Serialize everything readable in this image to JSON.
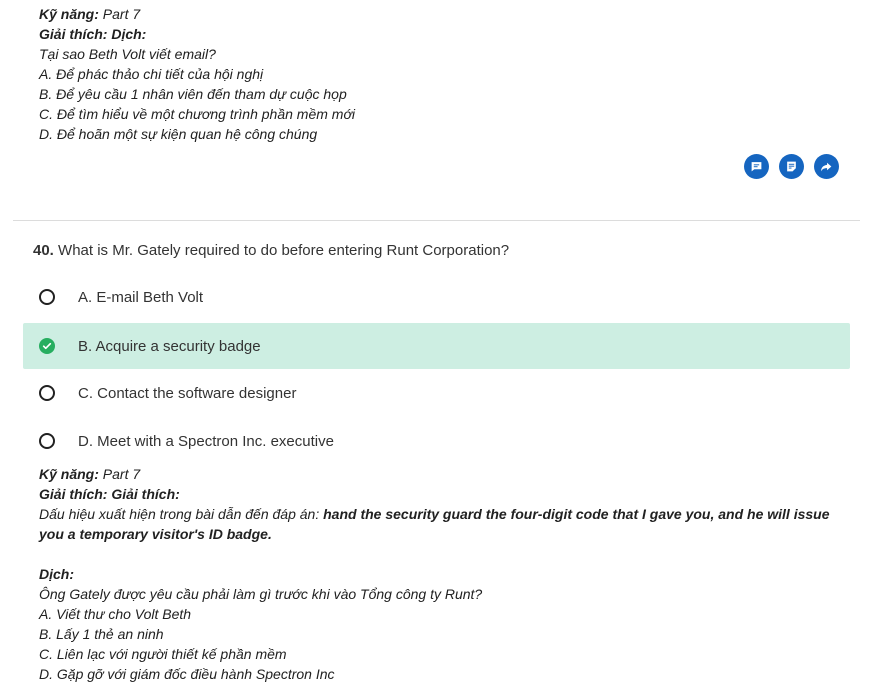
{
  "top_explanation": {
    "skill_label": "Kỹ năng:",
    "skill_value": "Part 7",
    "explain_header": "Giải thích: Dịch:",
    "lines": [
      "Tại sao Beth Volt viết email?",
      "A. Để phác thảo chi tiết của hội nghị",
      "B. Để yêu cầu 1 nhân viên đến tham dự cuộc họp",
      "C. Để tìm hiểu về một chương trình phần mềm mới",
      "D. Để hoãn một sự kiện quan hệ công chúng"
    ]
  },
  "action_icons": [
    "comment-icon",
    "note-icon",
    "share-icon"
  ],
  "question": {
    "number": "40.",
    "text": "What is Mr. Gately required to do before entering Runt Corporation?",
    "options": [
      {
        "label": "A. E-mail Beth Volt",
        "correct": false
      },
      {
        "label": "B. Acquire a security badge",
        "correct": true
      },
      {
        "label": "C. Contact the software designer",
        "correct": false
      },
      {
        "label": "D. Meet with a Spectron Inc. executive",
        "correct": false
      }
    ]
  },
  "bottom_explanation": {
    "skill_label": "Kỹ năng:",
    "skill_value": "Part 7",
    "explain_header": "Giải thích: Giải thích:",
    "clue_prefix": "Dấu hiệu xuất hiện trong bài dẫn đến đáp án:",
    "clue_bold": "hand the security guard the four-digit code that I gave you, and he will issue you a temporary visitor's ID badge.",
    "translation_header": "Dịch:",
    "lines": [
      "Ông Gately được yêu cầu phải làm gì trước khi vào Tổng công ty Runt?",
      "A. Viết thư cho Volt Beth",
      "B. Lấy 1 thẻ an ninh",
      "C. Liên lạc với người thiết kế phần mềm",
      "D. Gặp gỡ với giám đốc điều hành Spectron Inc"
    ]
  },
  "colors": {
    "accent": "#1565c0",
    "correct_bg": "#cdeee2",
    "correct_check": "#27ae60"
  }
}
